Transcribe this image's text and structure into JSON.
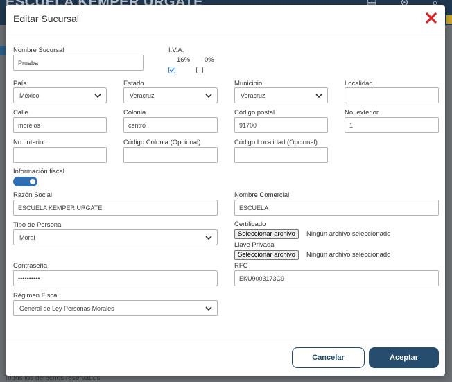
{
  "background": {
    "title": "ESCUELA KEMPER URGATE",
    "footer_text": "Todos los derechos reservados"
  },
  "modal": {
    "title": "Editar Sucursal",
    "close_color": "#e02020"
  },
  "form": {
    "nombre_sucursal": {
      "label": "Nombre Sucursal",
      "value": "Prueba"
    },
    "iva": {
      "label": "I.V.A.",
      "opt16": "16%",
      "opt0": "0%",
      "checked16": true,
      "checked0": false
    },
    "pais": {
      "label": "País",
      "value": "México"
    },
    "estado": {
      "label": "Estado",
      "value": "Veracruz"
    },
    "municipio": {
      "label": "Municipio",
      "value": "Veracruz"
    },
    "localidad": {
      "label": "Localidad",
      "value": ""
    },
    "calle": {
      "label": "Calle",
      "value": "morelos"
    },
    "colonia": {
      "label": "Colonia",
      "value": "centro"
    },
    "codigo_postal": {
      "label": "Código postal",
      "value": "91700"
    },
    "no_exterior": {
      "label": "No. exterior",
      "value": "1"
    },
    "no_interior": {
      "label": "No. interior",
      "value": ""
    },
    "codigo_colonia": {
      "label": "Código Colonia (Opcional)",
      "value": ""
    },
    "codigo_localidad": {
      "label": "Código Localidad (Opcional)",
      "value": ""
    },
    "info_fiscal": {
      "label": "Información fiscal",
      "enabled": true
    },
    "razon_social": {
      "label": "Razón Social",
      "value": "ESCUELA KEMPER URGATE"
    },
    "nombre_comercial": {
      "label": "Nombre Comercial",
      "value": "ESCUELA"
    },
    "tipo_persona": {
      "label": "Tipo de Persona",
      "value": "Moral"
    },
    "certificado": {
      "label": "Certificado",
      "button": "Seleccionar archivo",
      "status": "Ningún archivo seleccionado"
    },
    "llave_privada": {
      "label": "Llave Privada",
      "button": "Seleccionar archivo",
      "status": "Ningún archivo seleccionado"
    },
    "contrasena": {
      "label": "Contraseña",
      "value": "••••••••••"
    },
    "rfc": {
      "label": "RFC",
      "value": "EKU9003173C9"
    },
    "regimen_fiscal": {
      "label": "Régimen Fiscal",
      "value": "General de Ley Personas Morales"
    }
  },
  "buttons": {
    "cancel": "Cancelar",
    "accept": "Aceptar"
  },
  "colors": {
    "primary": "#264d6e",
    "toggle": "#2f6fb5",
    "checkbox": "#3d7bd9"
  }
}
